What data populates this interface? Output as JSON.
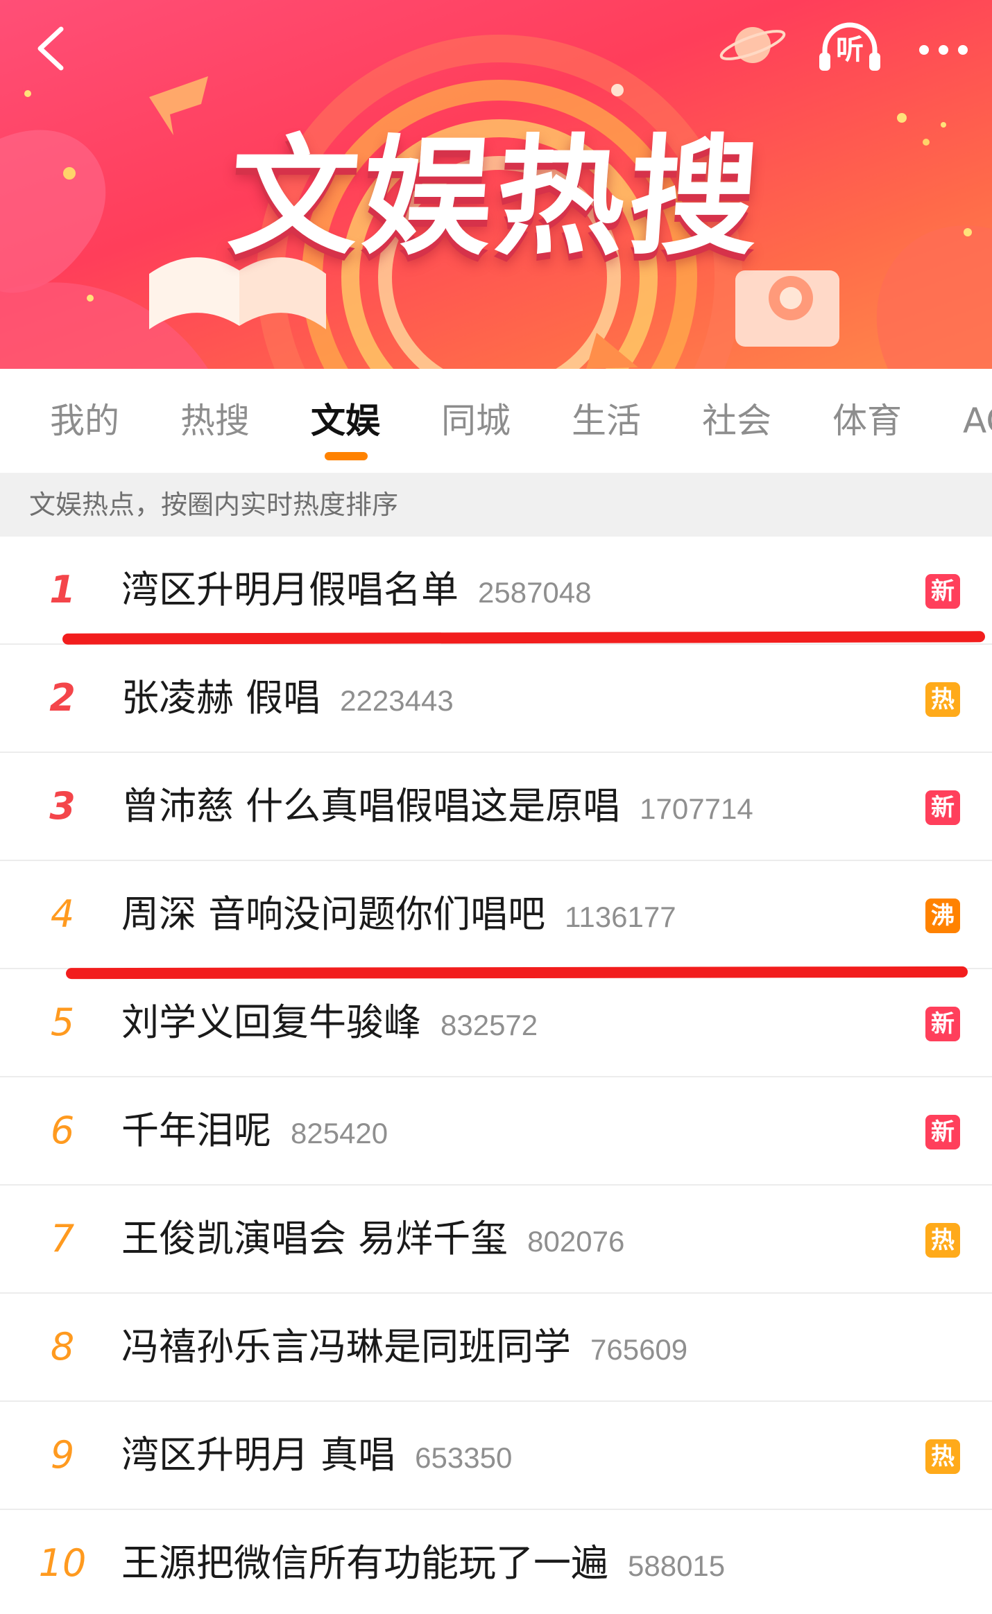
{
  "banner": {
    "title": "文娱热搜",
    "listen_label": "听"
  },
  "tabs": [
    {
      "label": "我的"
    },
    {
      "label": "热搜"
    },
    {
      "label": "文娱",
      "active": true
    },
    {
      "label": "同城"
    },
    {
      "label": "生活"
    },
    {
      "label": "社会"
    },
    {
      "label": "体育"
    },
    {
      "label": "AC"
    }
  ],
  "hint": "文娱热点，按圈内实时热度排序",
  "badge_colors": {
    "新": "#ff3f5b",
    "热": "#ffaa1a",
    "沸": "#ff8200"
  },
  "list": [
    {
      "rank": "1",
      "title": "湾区升明月假唱名单",
      "heat": "2587048",
      "badge": "新"
    },
    {
      "rank": "2",
      "title": "张凌赫 假唱",
      "heat": "2223443",
      "badge": "热"
    },
    {
      "rank": "3",
      "title": "曾沛慈 什么真唱假唱这是原唱",
      "heat": "1707714",
      "badge": "新"
    },
    {
      "rank": "4",
      "title": "周深 音响没问题你们唱吧",
      "heat": "1136177",
      "badge": "沸"
    },
    {
      "rank": "5",
      "title": "刘学义回复牛骏峰",
      "heat": "832572",
      "badge": "新"
    },
    {
      "rank": "6",
      "title": "千年泪呢",
      "heat": "825420",
      "badge": "新"
    },
    {
      "rank": "7",
      "title": "王俊凯演唱会 易烊千玺",
      "heat": "802076",
      "badge": "热"
    },
    {
      "rank": "8",
      "title": "冯禧孙乐言冯琳是同班同学",
      "heat": "765609",
      "badge": ""
    },
    {
      "rank": "9",
      "title": "湾区升明月 真唱",
      "heat": "653350",
      "badge": "热"
    },
    {
      "rank": "10",
      "title": "王源把微信所有功能玩了一遍",
      "heat": "588015",
      "badge": ""
    }
  ]
}
